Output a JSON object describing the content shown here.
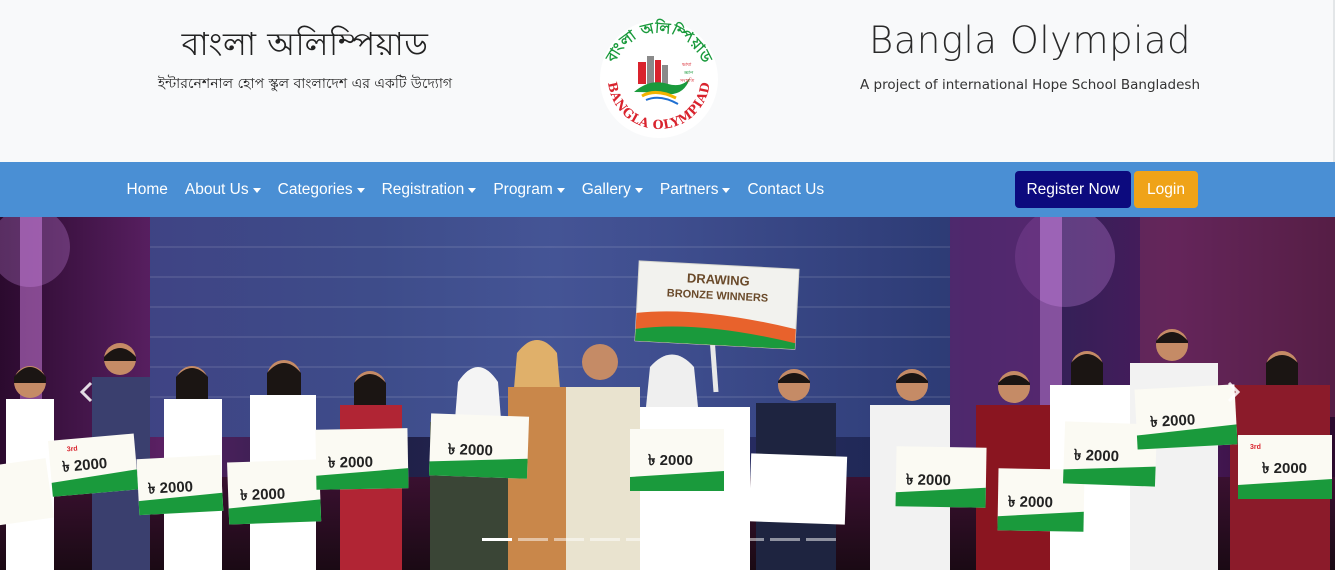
{
  "header": {
    "bn_title": "বাংলা অলিম্পিয়াড",
    "bn_subtitle": "ইন্টারনেশনাল হোপ স্কুল বাংলাদেশ এর একটি উদ্যোগ",
    "en_title": "Bangla Olympiad",
    "en_subtitle": "A project of international Hope School Bangladesh",
    "logo": {
      "arc_top": "বাংলা অলিম্পিয়াড",
      "arc_bottom": "BANGLA OLYMPIAD",
      "center_text": [
        "ভাষা",
        "জ্ঞান",
        "সংস্কৃতি"
      ],
      "colors": {
        "green": "#1a9a3c",
        "red": "#d9232d"
      }
    }
  },
  "nav": {
    "items": [
      {
        "label": "Home",
        "dropdown": false
      },
      {
        "label": "About Us",
        "dropdown": true
      },
      {
        "label": "Categories",
        "dropdown": true
      },
      {
        "label": "Registration",
        "dropdown": true
      },
      {
        "label": "Program",
        "dropdown": true
      },
      {
        "label": "Gallery",
        "dropdown": true
      },
      {
        "label": "Partners",
        "dropdown": true
      },
      {
        "label": "Contact Us",
        "dropdown": false
      }
    ],
    "register_label": "Register Now",
    "login_label": "Login",
    "colors": {
      "bar": "#4a8fd4",
      "register": "#0c0a7e",
      "login": "#efa318"
    }
  },
  "carousel": {
    "sign_title": "DRAWING",
    "sign_subtitle": "BRONZE WINNERS",
    "cheque_amount": "৳ 2000",
    "cheque_rank": "3rd",
    "slide_count": 10,
    "active_slide": 1
  }
}
